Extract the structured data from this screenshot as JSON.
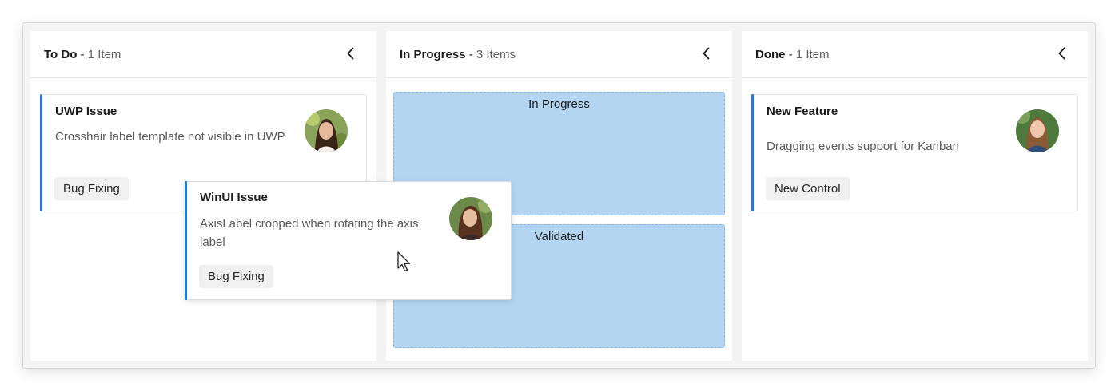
{
  "columns": [
    {
      "name": "To Do",
      "separator": " - ",
      "count_label": "1 Item",
      "cards": [
        {
          "title": "UWP Issue",
          "description": "Crosshair label template not visible in UWP",
          "tag": "Bug Fixing",
          "avatar": "avatar-woman-dark-hair"
        }
      ]
    },
    {
      "name": "In Progress",
      "separator": " - ",
      "count_label": "3 Items",
      "drop_zones": [
        {
          "label": "In Progress"
        },
        {
          "label": "Validated"
        }
      ]
    },
    {
      "name": "Done",
      "separator": " - ",
      "count_label": "1 Item",
      "cards": [
        {
          "title": "New Feature",
          "description": "Dragging events support for Kanban",
          "tag": "New Control",
          "avatar": "avatar-woman-long-hair"
        }
      ]
    }
  ],
  "dragged_card": {
    "title": "WinUI Issue",
    "description": "AxisLabel cropped when rotating the axis label",
    "tag": "Bug Fixing",
    "avatar": "avatar-woman-brown-hair"
  },
  "icons": {
    "collapse": "chevron-left-icon",
    "cursor": "mouse-pointer-icon"
  },
  "colors": {
    "accent": "#1f7ed4",
    "drop_zone": "#b3d5f2",
    "board_background": "#f4f4f4",
    "tag_background": "#f0f0f0"
  }
}
